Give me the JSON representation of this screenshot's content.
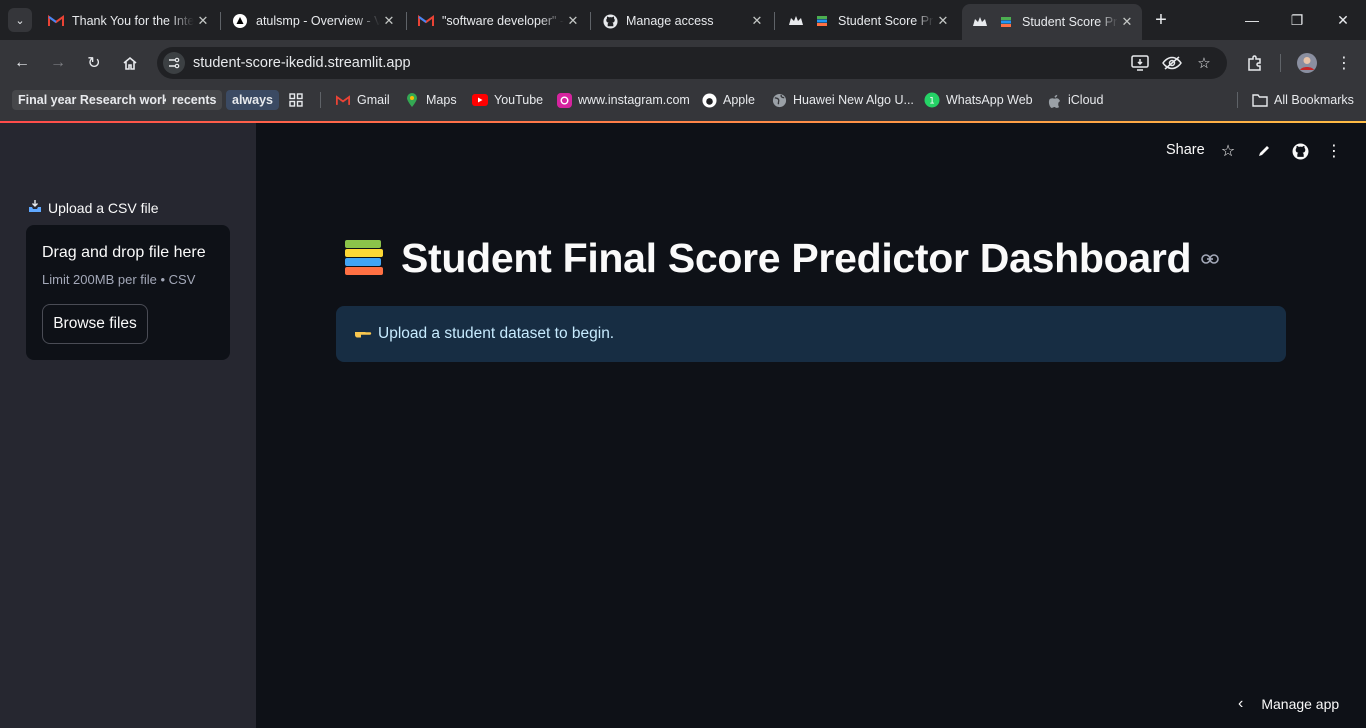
{
  "browser": {
    "tabs": [
      {
        "title": "Thank You for the Interview",
        "favicon": "gmail-icon"
      },
      {
        "title": "atulsmp - Overview - Vercel",
        "favicon": "vercel-icon"
      },
      {
        "title": "\"software developer\" - Gmail",
        "favicon": "gmail-icon"
      },
      {
        "title": "Manage access",
        "favicon": "github-icon"
      },
      {
        "title": "Student Score Predictor",
        "favicon": "streamlit-icon"
      },
      {
        "title": "Student Score Predictor",
        "favicon": "streamlit-icon",
        "active": true
      }
    ],
    "url": "student-score-ikedid.streamlit.app",
    "bookmarks": [
      {
        "label": "Final year Research work"
      },
      {
        "label": "recents"
      },
      {
        "label": "always"
      },
      {
        "label": "Gmail"
      },
      {
        "label": "Maps"
      },
      {
        "label": "YouTube"
      },
      {
        "label": "www.instagram.com"
      },
      {
        "label": "Apple"
      },
      {
        "label": "Huawei New Algo U..."
      },
      {
        "label": "WhatsApp Web"
      },
      {
        "label": "iCloud"
      },
      {
        "label": "All Bookmarks"
      }
    ]
  },
  "app": {
    "toolbar": {
      "share_label": "Share"
    },
    "sidebar": {
      "upload_label": "Upload a CSV file",
      "dropzone_title": "Drag and drop file here",
      "dropzone_limit": "Limit 200MB per file • CSV",
      "browse_label": "Browse files"
    },
    "main": {
      "title": "Student Final Score Predictor Dashboard",
      "info_message": "Upload a student dataset to begin."
    },
    "footer": {
      "manage_label": "Manage app"
    }
  },
  "colors": {
    "main_bg": "#0e1117",
    "sidebar_bg": "#262730",
    "info_bg": "#172d43",
    "info_text": "#c7ebff",
    "accent_red": "#ff4b4b"
  }
}
